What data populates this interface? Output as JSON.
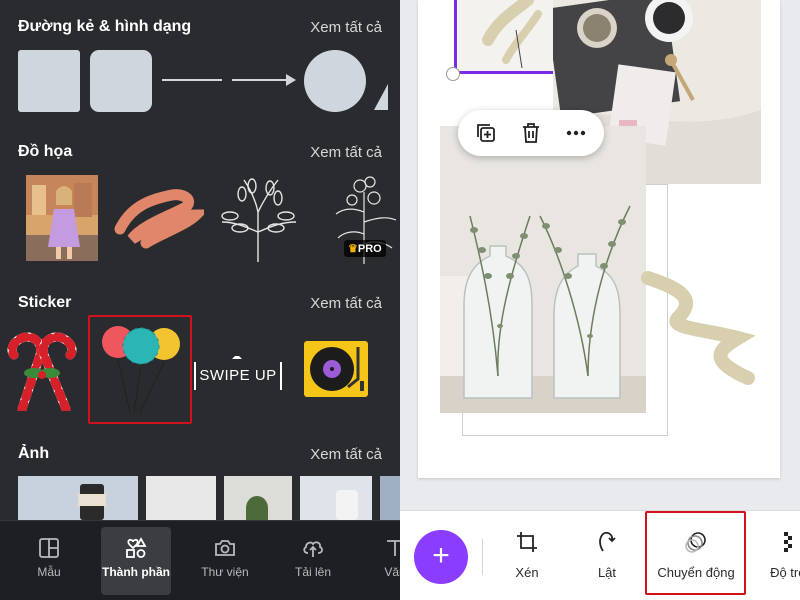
{
  "left_panel": {
    "sections": [
      {
        "title": "Đường kẻ & hình dạng",
        "see_all": "Xem tất cả"
      },
      {
        "title": "Đồ họa",
        "see_all": "Xem tất cả"
      },
      {
        "title": "Sticker",
        "see_all": "Xem tất cả"
      },
      {
        "title": "Ảnh",
        "see_all": "Xem tất cả"
      }
    ],
    "graphics": {
      "pro_label": "PRO"
    },
    "stickers": {
      "swipe_up_text": "SWIPE UP"
    },
    "bottom_nav": [
      {
        "label": "Mẫu",
        "icon": "template-icon",
        "active": false
      },
      {
        "label": "Thành phần",
        "icon": "elements-icon",
        "active": true
      },
      {
        "label": "Thư viện",
        "icon": "camera-icon",
        "active": false
      },
      {
        "label": "Tải lên",
        "icon": "upload-icon",
        "active": false
      },
      {
        "label": "Văn",
        "icon": "text-icon",
        "active": false
      }
    ]
  },
  "context_menu": {
    "items": [
      "duplicate-icon",
      "delete-icon",
      "more-icon"
    ]
  },
  "toolbar": {
    "add_label": "+",
    "items": [
      {
        "label": "Xén",
        "icon": "crop-icon"
      },
      {
        "label": "Lật",
        "icon": "flip-icon"
      },
      {
        "label": "Chuyển động",
        "icon": "animate-icon"
      },
      {
        "label": "Độ trong",
        "icon": "transparency-icon"
      }
    ]
  },
  "colors": {
    "panel_bg": "#292b2f",
    "accent_purple": "#8b3dff",
    "highlight_red": "#d0121d",
    "selection_purple": "#7d2ae8"
  }
}
